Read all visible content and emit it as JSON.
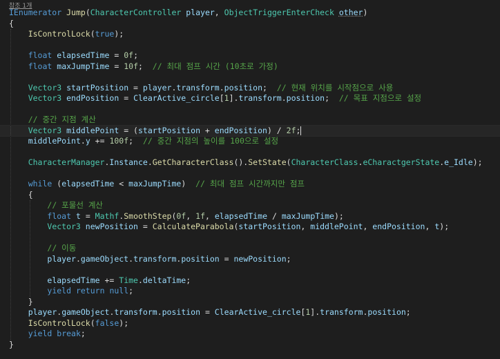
{
  "codelens": "참조 1개",
  "lines": [
    [
      [
        "kw",
        "IEnumerator"
      ],
      [
        "pl",
        " "
      ],
      [
        "fn",
        "Jump"
      ],
      [
        "pl",
        "("
      ],
      [
        "ty",
        "CharacterController"
      ],
      [
        "pl",
        " "
      ],
      [
        "vr",
        "player"
      ],
      [
        "pl",
        ", "
      ],
      [
        "ty",
        "ObjectTriggerEnterCheck"
      ],
      [
        "pl",
        " "
      ],
      [
        "vr",
        "other"
      ],
      [
        "pl",
        ")"
      ]
    ],
    [
      [
        "pl",
        "{"
      ]
    ],
    [
      [
        "pl",
        "    "
      ],
      [
        "fn",
        "IsControlLock"
      ],
      [
        "pl",
        "("
      ],
      [
        "kw",
        "true"
      ],
      [
        "pl",
        ");"
      ]
    ],
    [],
    [
      [
        "pl",
        "    "
      ],
      [
        "kw",
        "float"
      ],
      [
        "pl",
        " "
      ],
      [
        "vr",
        "elapsedTime"
      ],
      [
        "pl",
        " = "
      ],
      [
        "nm",
        "0f"
      ],
      [
        "pl",
        ";"
      ]
    ],
    [
      [
        "pl",
        "    "
      ],
      [
        "kw",
        "float"
      ],
      [
        "pl",
        " "
      ],
      [
        "vr",
        "maxJumpTime"
      ],
      [
        "pl",
        " = "
      ],
      [
        "nm",
        "10f"
      ],
      [
        "pl",
        ";  "
      ],
      [
        "cm",
        "// 최대 점프 시간 (10초로 가정)"
      ]
    ],
    [],
    [
      [
        "pl",
        "    "
      ],
      [
        "ty",
        "Vector3"
      ],
      [
        "pl",
        " "
      ],
      [
        "vr",
        "startPosition"
      ],
      [
        "pl",
        " = "
      ],
      [
        "vr",
        "player"
      ],
      [
        "pl",
        "."
      ],
      [
        "vr",
        "transform"
      ],
      [
        "pl",
        "."
      ],
      [
        "vr",
        "position"
      ],
      [
        "pl",
        ";  "
      ],
      [
        "cm",
        "// 현재 위치를 시작점으로 사용"
      ]
    ],
    [
      [
        "pl",
        "    "
      ],
      [
        "ty",
        "Vector3"
      ],
      [
        "pl",
        " "
      ],
      [
        "vr",
        "endPosition"
      ],
      [
        "pl",
        " = "
      ],
      [
        "vr",
        "ClearActive_circle"
      ],
      [
        "pl",
        "["
      ],
      [
        "nm",
        "1"
      ],
      [
        "pl",
        "]."
      ],
      [
        "vr",
        "transform"
      ],
      [
        "pl",
        "."
      ],
      [
        "vr",
        "position"
      ],
      [
        "pl",
        ";  "
      ],
      [
        "cm",
        "// 목표 지점으로 설정"
      ]
    ],
    [],
    [
      [
        "pl",
        "    "
      ],
      [
        "cm",
        "// 중간 지점 계산"
      ]
    ],
    [
      [
        "pl",
        "    "
      ],
      [
        "ty",
        "Vector3"
      ],
      [
        "pl",
        " "
      ],
      [
        "vr",
        "middlePoint"
      ],
      [
        "pl",
        " = ("
      ],
      [
        "vr",
        "startPosition"
      ],
      [
        "pl",
        " + "
      ],
      [
        "vr",
        "endPosition"
      ],
      [
        "pl",
        ") / "
      ],
      [
        "nm",
        "2f"
      ],
      [
        "pl",
        ";"
      ]
    ],
    [
      [
        "pl",
        "    "
      ],
      [
        "vr",
        "middlePoint"
      ],
      [
        "pl",
        "."
      ],
      [
        "vr",
        "y"
      ],
      [
        "pl",
        " += "
      ],
      [
        "nm",
        "100f"
      ],
      [
        "pl",
        ";  "
      ],
      [
        "cm",
        "// 중간 지점의 높이를 100으로 설정"
      ]
    ],
    [],
    [
      [
        "pl",
        "    "
      ],
      [
        "ty",
        "CharacterManager"
      ],
      [
        "pl",
        "."
      ],
      [
        "vr",
        "Instance"
      ],
      [
        "pl",
        "."
      ],
      [
        "fn",
        "GetCharacterClass"
      ],
      [
        "pl",
        "()."
      ],
      [
        "fn",
        "SetState"
      ],
      [
        "pl",
        "("
      ],
      [
        "ty",
        "CharacterClass"
      ],
      [
        "pl",
        "."
      ],
      [
        "ty",
        "eCharactgerState"
      ],
      [
        "pl",
        "."
      ],
      [
        "vr",
        "e_Idle"
      ],
      [
        "pl",
        ");"
      ]
    ],
    [],
    [
      [
        "pl",
        "    "
      ],
      [
        "kw",
        "while"
      ],
      [
        "pl",
        " ("
      ],
      [
        "vr",
        "elapsedTime"
      ],
      [
        "pl",
        " < "
      ],
      [
        "vr",
        "maxJumpTime"
      ],
      [
        "pl",
        ")  "
      ],
      [
        "cm",
        "// 최대 점프 시간까지만 점프"
      ]
    ],
    [
      [
        "pl",
        "    {"
      ]
    ],
    [
      [
        "pl",
        "        "
      ],
      [
        "cm",
        "// 포물선 계산"
      ]
    ],
    [
      [
        "pl",
        "        "
      ],
      [
        "kw",
        "float"
      ],
      [
        "pl",
        " "
      ],
      [
        "vr",
        "t"
      ],
      [
        "pl",
        " = "
      ],
      [
        "ty",
        "Mathf"
      ],
      [
        "pl",
        "."
      ],
      [
        "fn",
        "SmoothStep"
      ],
      [
        "pl",
        "("
      ],
      [
        "nm",
        "0f"
      ],
      [
        "pl",
        ", "
      ],
      [
        "nm",
        "1f"
      ],
      [
        "pl",
        ", "
      ],
      [
        "vr",
        "elapsedTime"
      ],
      [
        "pl",
        " / "
      ],
      [
        "vr",
        "maxJumpTime"
      ],
      [
        "pl",
        ");"
      ]
    ],
    [
      [
        "pl",
        "        "
      ],
      [
        "ty",
        "Vector3"
      ],
      [
        "pl",
        " "
      ],
      [
        "vr",
        "newPosition"
      ],
      [
        "pl",
        " = "
      ],
      [
        "fn",
        "CalculateParabola"
      ],
      [
        "pl",
        "("
      ],
      [
        "vr",
        "startPosition"
      ],
      [
        "pl",
        ", "
      ],
      [
        "vr",
        "middlePoint"
      ],
      [
        "pl",
        ", "
      ],
      [
        "vr",
        "endPosition"
      ],
      [
        "pl",
        ", "
      ],
      [
        "vr",
        "t"
      ],
      [
        "pl",
        ");"
      ]
    ],
    [],
    [
      [
        "pl",
        "        "
      ],
      [
        "cm",
        "// 이동"
      ]
    ],
    [
      [
        "pl",
        "        "
      ],
      [
        "vr",
        "player"
      ],
      [
        "pl",
        "."
      ],
      [
        "vr",
        "gameObject"
      ],
      [
        "pl",
        "."
      ],
      [
        "vr",
        "transform"
      ],
      [
        "pl",
        "."
      ],
      [
        "vr",
        "position"
      ],
      [
        "pl",
        " = "
      ],
      [
        "vr",
        "newPosition"
      ],
      [
        "pl",
        ";"
      ]
    ],
    [],
    [
      [
        "pl",
        "        "
      ],
      [
        "vr",
        "elapsedTime"
      ],
      [
        "pl",
        " += "
      ],
      [
        "ty",
        "Time"
      ],
      [
        "pl",
        "."
      ],
      [
        "vr",
        "deltaTime"
      ],
      [
        "pl",
        ";"
      ]
    ],
    [
      [
        "pl",
        "        "
      ],
      [
        "kw",
        "yield"
      ],
      [
        "pl",
        " "
      ],
      [
        "kw",
        "return"
      ],
      [
        "pl",
        " "
      ],
      [
        "kw",
        "null"
      ],
      [
        "pl",
        ";"
      ]
    ],
    [
      [
        "pl",
        "    }"
      ]
    ],
    [
      [
        "pl",
        "    "
      ],
      [
        "vr",
        "player"
      ],
      [
        "pl",
        "."
      ],
      [
        "vr",
        "gameObject"
      ],
      [
        "pl",
        "."
      ],
      [
        "vr",
        "transform"
      ],
      [
        "pl",
        "."
      ],
      [
        "vr",
        "position"
      ],
      [
        "pl",
        " = "
      ],
      [
        "vr",
        "ClearActive_circle"
      ],
      [
        "pl",
        "["
      ],
      [
        "nm",
        "1"
      ],
      [
        "pl",
        "]."
      ],
      [
        "vr",
        "transform"
      ],
      [
        "pl",
        "."
      ],
      [
        "vr",
        "position"
      ],
      [
        "pl",
        ";"
      ]
    ],
    [
      [
        "pl",
        "    "
      ],
      [
        "fn",
        "IsControlLock"
      ],
      [
        "pl",
        "("
      ],
      [
        "kw",
        "false"
      ],
      [
        "pl",
        ");"
      ]
    ],
    [
      [
        "pl",
        "    "
      ],
      [
        "kw",
        "yield"
      ],
      [
        "pl",
        " "
      ],
      [
        "kw",
        "break"
      ],
      [
        "pl",
        ";"
      ]
    ],
    [
      [
        "pl",
        "}"
      ]
    ]
  ],
  "highlighted_line": 11
}
